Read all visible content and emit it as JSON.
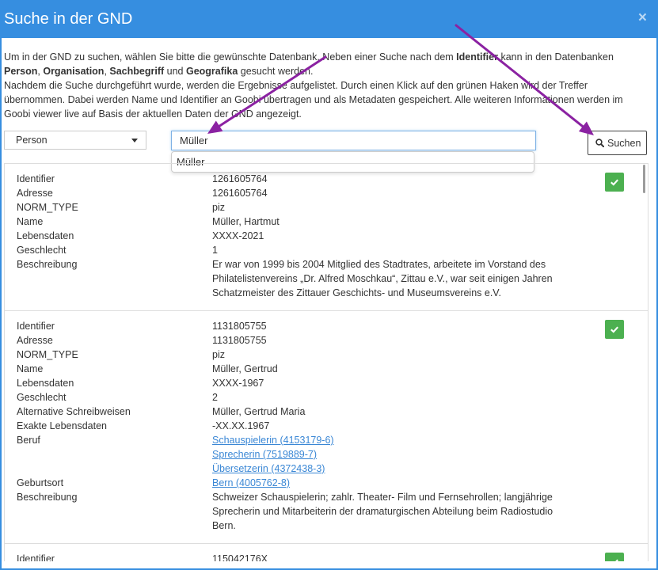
{
  "dialog": {
    "title": "Suche in der GND",
    "close_label": "×",
    "close_icon": "close-icon"
  },
  "colors": {
    "header": "#368ee0",
    "frame": "#368ee0",
    "accept_button": "#4cb050",
    "link": "#3a87d5",
    "annotation_arrow": "#8b22a2"
  },
  "intro": {
    "lines": [
      [
        {
          "text": "Um in der GND zu suchen, wählen Sie bitte die gewünschte Datenbank. Neben einer Suche nach dem "
        },
        {
          "text": "Identifier",
          "bold": true
        },
        {
          "text": " kann in den Datenbanken"
        }
      ],
      [
        {
          "text": "Person",
          "bold": true
        },
        {
          "text": ", "
        },
        {
          "text": "Organisation",
          "bold": true
        },
        {
          "text": ", "
        },
        {
          "text": "Sachbegriff",
          "bold": true
        },
        {
          "text": " und "
        },
        {
          "text": "Geografika",
          "bold": true
        },
        {
          "text": " gesucht werden."
        }
      ],
      [
        {
          "text": "Nachdem die Suche durchgeführt wurde, werden die Ergebnisse aufgelistet. Durch einen Klick auf den grünen Haken wird der Treffer"
        }
      ],
      [
        {
          "text": "übernommen. Dabei werden Name und Identifier an Goobi übertragen und als Metadaten gespeichert. Alle weiteren Informationen werden im"
        }
      ],
      [
        {
          "text": "Goobi viewer live auf Basis der aktuellen Daten der GND angezeigt."
        }
      ]
    ]
  },
  "search": {
    "database_select": {
      "selected": "Person",
      "icon": "caret-down-icon"
    },
    "query_input": {
      "value": "Müller"
    },
    "suggestions": [
      {
        "label": "Müller"
      }
    ],
    "submit_button": {
      "label": "Suchen",
      "icon": "search-icon"
    }
  },
  "result_list": {
    "accept_icon": "check-icon",
    "items": [
      {
        "fields": [
          {
            "label": "Identifier",
            "values": [
              "1261605764"
            ]
          },
          {
            "label": "Adresse",
            "values": [
              "1261605764"
            ]
          },
          {
            "label": "NORM_TYPE",
            "values": [
              "piz"
            ]
          },
          {
            "label": "Name",
            "values": [
              "Müller, Hartmut"
            ]
          },
          {
            "label": "Lebensdaten",
            "values": [
              "XXXX-2021"
            ]
          },
          {
            "label": "Geschlecht",
            "values": [
              "1"
            ]
          },
          {
            "label": "Beschreibung",
            "values": [
              "Er war von 1999 bis 2004 Mitglied des Stadtrates, arbeitete im Vorstand des",
              "Philatelistenvereins „Dr. Alfred Moschkau“, Zittau e.V., war seit einigen Jahren",
              "Schatzmeister des Zittauer Geschichts- und Museumsvereins e.V."
            ]
          }
        ]
      },
      {
        "fields": [
          {
            "label": "Identifier",
            "values": [
              "1131805755"
            ]
          },
          {
            "label": "Adresse",
            "values": [
              "1131805755"
            ]
          },
          {
            "label": "NORM_TYPE",
            "values": [
              "piz"
            ]
          },
          {
            "label": "Name",
            "values": [
              "Müller, Gertrud"
            ]
          },
          {
            "label": "Lebensdaten",
            "values": [
              "XXXX-1967"
            ]
          },
          {
            "label": "Geschlecht",
            "values": [
              "2"
            ]
          },
          {
            "label": "Alternative Schreibweisen",
            "values": [
              "Müller, Gertrud Maria"
            ]
          },
          {
            "label": "Exakte Lebensdaten",
            "values": [
              "-XX.XX.1967"
            ]
          },
          {
            "label": "Beruf",
            "link": true,
            "values": [
              "Schauspielerin (4153179-6)",
              "Sprecherin (7519889-7)",
              "Übersetzerin (4372438-3)"
            ]
          },
          {
            "label": "Geburtsort",
            "link": true,
            "values": [
              "Bern (4005762-8)"
            ]
          },
          {
            "label": "Beschreibung",
            "values": [
              "Schweizer Schauspielerin; zahlr. Theater- Film und Fernsehrollen; langjährige",
              "Sprecherin und Mitarbeiterin der dramaturgischen Abteilung beim Radiostudio",
              "Bern."
            ]
          }
        ]
      },
      {
        "fields": [
          {
            "label": "Identifier",
            "values": [
              "115042176X"
            ]
          }
        ]
      }
    ]
  }
}
